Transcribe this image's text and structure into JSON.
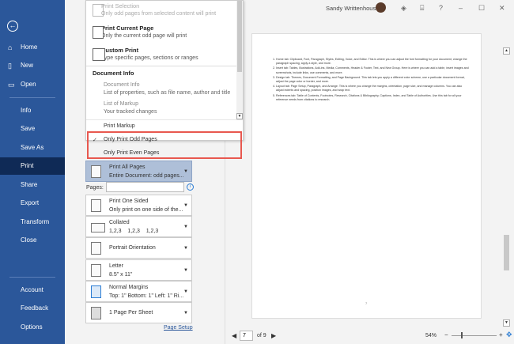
{
  "sidebar": {
    "items": [
      {
        "label": "Home",
        "icon": "home-icon"
      },
      {
        "label": "New",
        "icon": "new-document-icon"
      },
      {
        "label": "Open",
        "icon": "folder-icon"
      },
      {
        "label": "Info"
      },
      {
        "label": "Save"
      },
      {
        "label": "Save As"
      },
      {
        "label": "Print",
        "active": true
      },
      {
        "label": "Share"
      },
      {
        "label": "Export"
      },
      {
        "label": "Transform"
      },
      {
        "label": "Close"
      },
      {
        "label": "Account"
      },
      {
        "label": "Feedback"
      },
      {
        "label": "Options"
      }
    ]
  },
  "dropdown": {
    "print_selection": {
      "title": "Print Selection",
      "sub": "Only odd pages from selected content will print"
    },
    "print_current": {
      "title": "Print Current Page",
      "sub": "Only the current odd page will print"
    },
    "custom_print": {
      "title": "Custom Print",
      "sub": "Type specific pages, sections or ranges"
    },
    "doc_info_header": "Document Info",
    "doc_info": {
      "title": "Document Info",
      "sub": "List of properties, such as file name, author and title"
    },
    "markup_list": {
      "title": "List of Markup",
      "sub": "Your tracked changes"
    },
    "print_markup": "Print Markup",
    "odd": "Only Print Odd Pages",
    "even": "Only Print Even Pages",
    "check": "✓"
  },
  "settings": {
    "print_pages": {
      "t1": "Print All Pages",
      "t2": "Entire Document: odd pages..."
    },
    "pages_label": "Pages:",
    "pages_value": "",
    "sided": {
      "t1": "Print One Sided",
      "t2": "Only print on one side of the..."
    },
    "collated": {
      "t1": "Collated",
      "t2": "1,2,3    1,2,3    1,2,3"
    },
    "orientation": "Portrait Orientation",
    "paper": {
      "t1": "Letter",
      "t2": "8.5\" x 11\""
    },
    "margins": {
      "t1": "Normal Margins",
      "t2": "Top: 1\" Bottom: 1\" Left: 1\" Ri..."
    },
    "per_sheet": "1 Page Per Sheet",
    "page_setup": "Page Setup"
  },
  "titlebar": {
    "user": "Sandy Writtenhouse",
    "help": "?",
    "min": "–",
    "max": "☐",
    "close": "✕"
  },
  "document": {
    "items": [
      "Home tab: Clipboard, Font, Paragraph, Styles, Editing, Voice, and Editor. This is where you can adjust the font formatting for your document, change the paragraph spacing, apply a style, and more.",
      "Insert tab: Tables, Illustrations, Add-ins, Media, Comments, Header & Footer, Text, and New Group. Here is where you can add a table, insert images and screenshots, include links, use comments, and more.",
      "Design tab: Themes, Document Formatting, and Page Background. This tab lets you apply a different color scheme, use a particular document format, adjust the page color or border, and more.",
      "Layout tab: Page Setup, Paragraph, and Arrange. This is where you change the margins, orientation, page size, and manage columns. You can also adjust indents and spacing, position images, and wrap text.",
      "References tab: Table of Contents, Footnotes, Research, Citations & Bibliography, Captions, Index, and Table of Authorities. Use this tab for all your reference needs from citations to research."
    ],
    "page_number": "7"
  },
  "nav": {
    "current_page": "7",
    "of": "of 9",
    "zoom": "54%"
  },
  "colors": {
    "sidebar": "#2b579a",
    "highlight": "#e8584f"
  }
}
